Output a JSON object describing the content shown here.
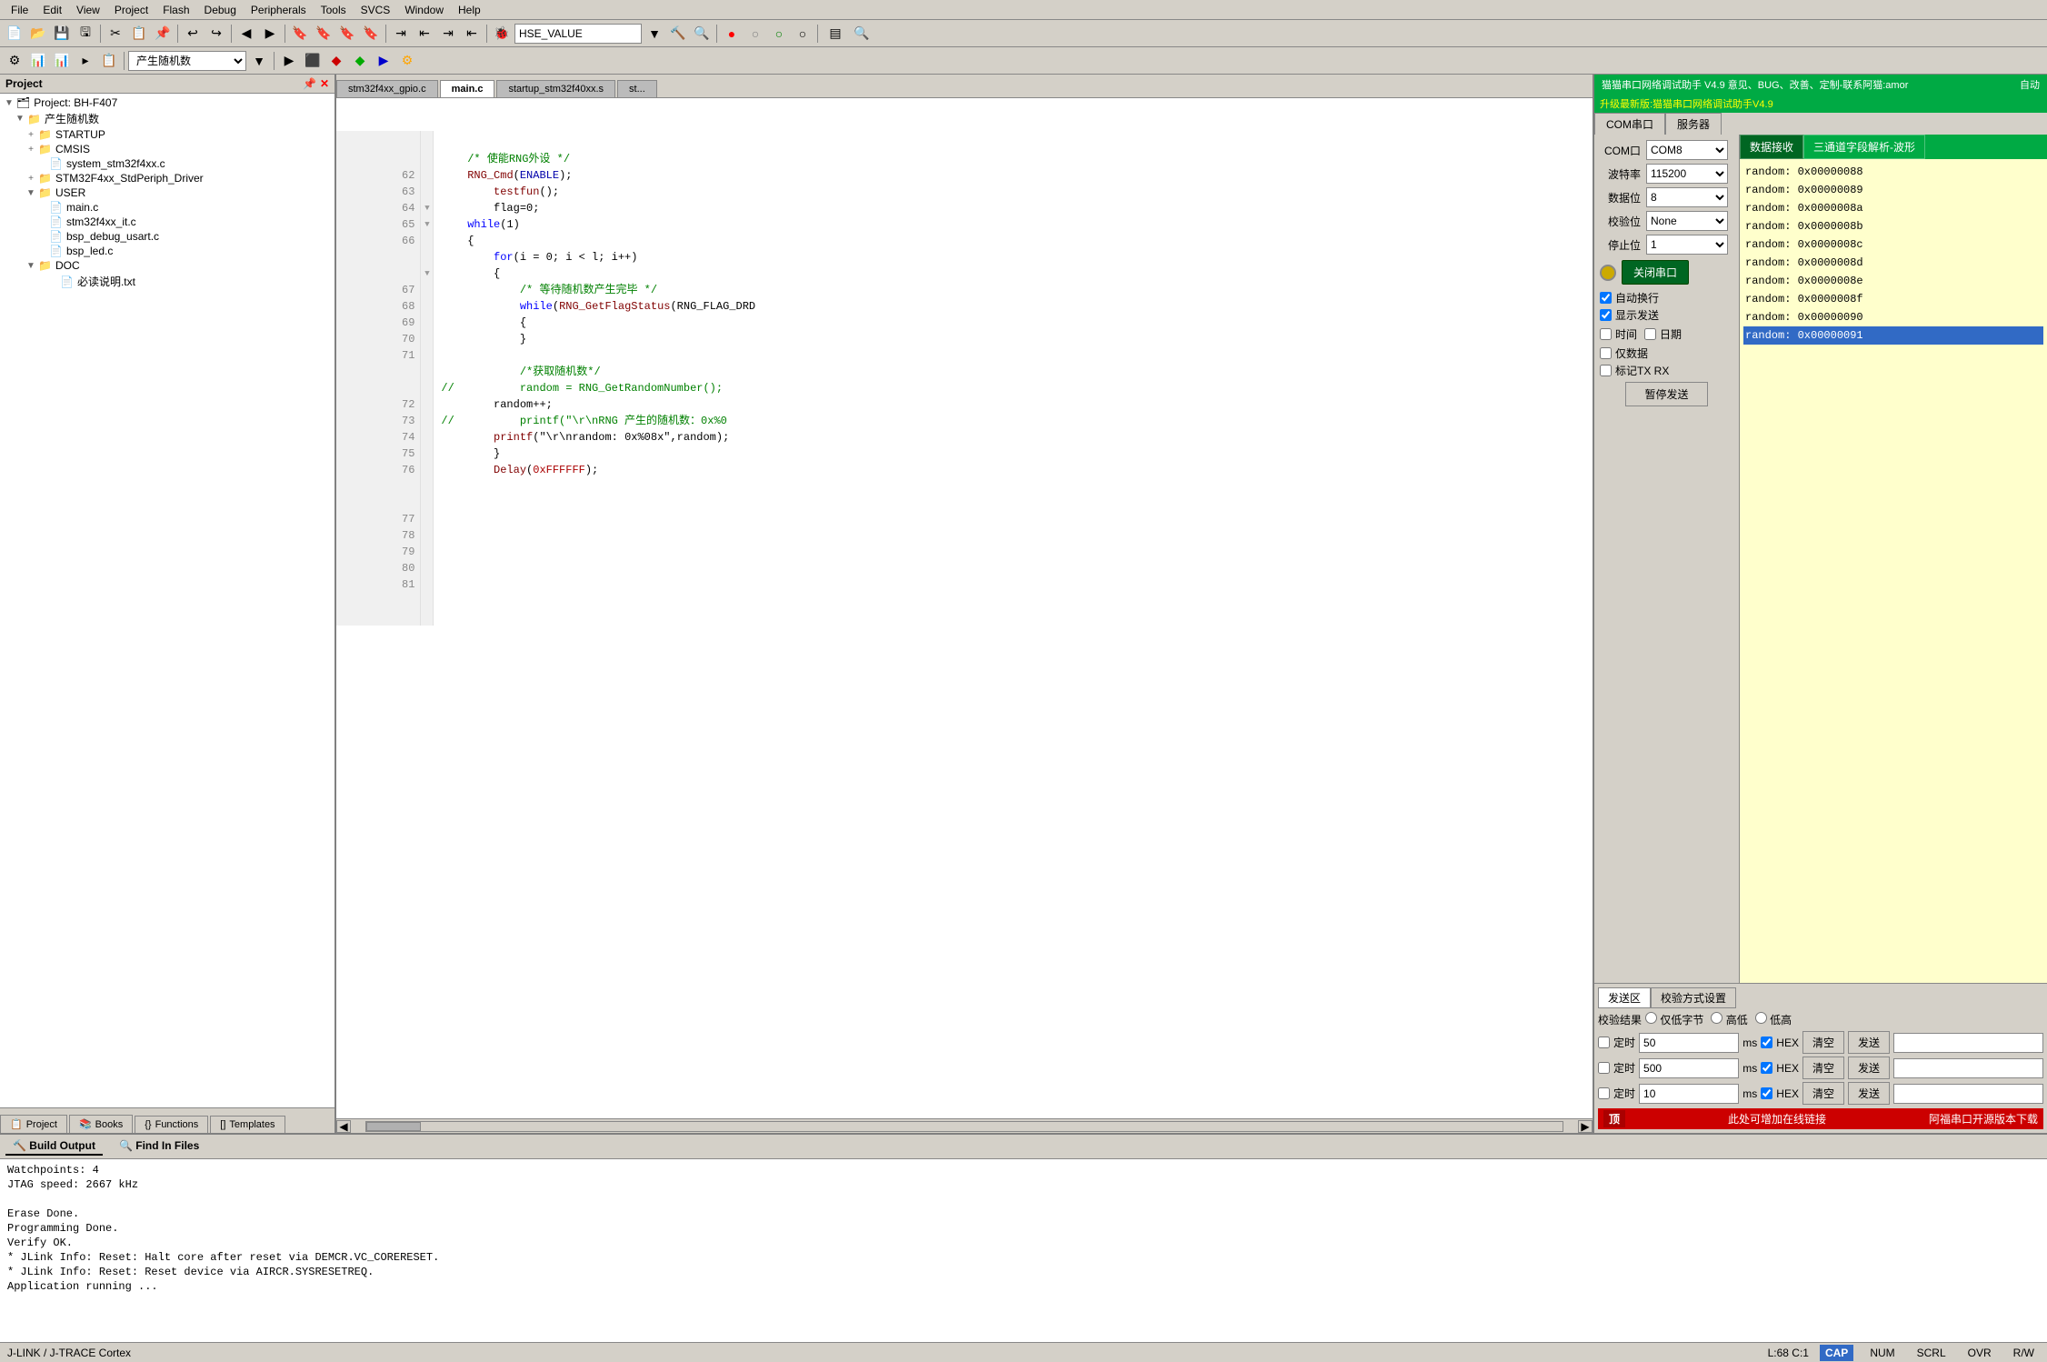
{
  "menu": {
    "items": [
      "File",
      "Edit",
      "View",
      "Project",
      "Flash",
      "Debug",
      "Peripherals",
      "Tools",
      "SVCS",
      "Window",
      "Help"
    ]
  },
  "toolbar": {
    "hse_value": "HSE_VALUE",
    "random_btn": "产生随机数"
  },
  "project_panel": {
    "title": "Project",
    "tree": [
      {
        "label": "Project: BH-F407",
        "level": 0,
        "type": "project",
        "expanded": true
      },
      {
        "label": "产生随机数",
        "level": 1,
        "type": "folder",
        "expanded": true
      },
      {
        "label": "STARTUP",
        "level": 2,
        "type": "folder",
        "expanded": true
      },
      {
        "label": "CMSIS",
        "level": 2,
        "type": "folder",
        "expanded": true
      },
      {
        "label": "system_stm32f4xx.c",
        "level": 3,
        "type": "file"
      },
      {
        "label": "STM32F4xx_StdPeriph_Driver",
        "level": 2,
        "type": "folder",
        "expanded": false
      },
      {
        "label": "USER",
        "level": 2,
        "type": "folder",
        "expanded": true
      },
      {
        "label": "main.c",
        "level": 3,
        "type": "file"
      },
      {
        "label": "stm32f4xx_it.c",
        "level": 3,
        "type": "file"
      },
      {
        "label": "bsp_debug_usart.c",
        "level": 3,
        "type": "file"
      },
      {
        "label": "bsp_led.c",
        "level": 3,
        "type": "file"
      },
      {
        "label": "DOC",
        "level": 2,
        "type": "folder",
        "expanded": true
      },
      {
        "label": "必读说明.txt",
        "level": 3,
        "type": "file"
      }
    ],
    "tabs": [
      {
        "label": "Project",
        "icon": "📋",
        "active": false
      },
      {
        "label": "Books",
        "icon": "📚",
        "active": false
      },
      {
        "label": "Functions",
        "icon": "{}",
        "active": false
      },
      {
        "label": "Templates",
        "icon": "[]",
        "active": false
      }
    ]
  },
  "editor": {
    "tabs": [
      {
        "label": "stm32f4xx_gpio.c",
        "active": false
      },
      {
        "label": "main.c",
        "active": true
      },
      {
        "label": "startup_stm32f40xx.s",
        "active": false
      },
      {
        "label": "st...",
        "active": false
      }
    ],
    "lines": [
      {
        "num": 62,
        "fold": "",
        "text": "    /* 使能RNG外设 */"
      },
      {
        "num": 63,
        "fold": "",
        "text": "    RNG_Cmd(ENABLE);"
      },
      {
        "num": 64,
        "fold": "",
        "text": "        testfun();"
      },
      {
        "num": 65,
        "fold": "",
        "text": "        flag=0;"
      },
      {
        "num": 66,
        "fold": "",
        "text": "    while(1)"
      },
      {
        "num": 67,
        "fold": "▼",
        "text": "    {"
      },
      {
        "num": 68,
        "fold": "",
        "text": "        for(i = 0; i < l; i++)"
      },
      {
        "num": 69,
        "fold": "▼",
        "text": "        {"
      },
      {
        "num": 70,
        "fold": "",
        "text": "            /* 等待随机数产生完毕 */"
      },
      {
        "num": 71,
        "fold": "",
        "text": "            while(RNG_GetFlagStatus(RNG_FLAG_DRD"
      },
      {
        "num": 72,
        "fold": "▼",
        "text": "            {"
      },
      {
        "num": 73,
        "fold": "",
        "text": "            }"
      },
      {
        "num": 74,
        "fold": "",
        "text": ""
      },
      {
        "num": 75,
        "fold": "",
        "text": "            /*获取随机数*/"
      },
      {
        "num": 76,
        "fold": "",
        "text": "//          random = RNG_GetRandomNumber();"
      },
      {
        "num": 77,
        "fold": "",
        "text": "        random++;"
      },
      {
        "num": 78,
        "fold": "",
        "text": "//          printf(\"\\r\\nRNG 产生的随机数：0x%0"
      },
      {
        "num": 79,
        "fold": "",
        "text": "        printf(\"\\r\\nrandom: 0x%08x\",random);"
      },
      {
        "num": 80,
        "fold": "",
        "text": "        }"
      },
      {
        "num": 81,
        "fold": "",
        "text": "        Delay(0xFFFFFF);"
      }
    ]
  },
  "serial": {
    "app_name": "猫猫串口网络调试助手 V4.9 意见、BUG、改善、定制-联系阿猫:amor",
    "upgrade": "升级最新版:猫猫串口网络调试助手V4.9",
    "auto_label": "自动",
    "tabs_main": [
      "COM串口",
      "服务器"
    ],
    "tabs_sub": [
      "数据接收",
      "三通道字段解析-波形"
    ],
    "settings": {
      "com_label": "COM口",
      "com_value": "COM8",
      "baud_label": "波特率",
      "baud_value": "115200",
      "data_label": "数据位",
      "data_value": "8",
      "parity_label": "校验位",
      "parity_value": "None",
      "stop_label": "停止位",
      "stop_value": "1",
      "close_btn": "关闭串口"
    },
    "checkboxes": [
      {
        "label": "自动换行",
        "checked": true
      },
      {
        "label": "显示发送",
        "checked": true
      },
      {
        "label": "时间",
        "checked": false
      },
      {
        "label": "日期",
        "checked": false
      },
      {
        "label": "仅数据",
        "checked": false
      },
      {
        "label": "标记TX RX",
        "checked": false
      }
    ],
    "pause_btn": "暂停发送",
    "data_lines": [
      {
        "text": "random: 0x00000088",
        "highlight": false
      },
      {
        "text": "random: 0x00000089",
        "highlight": false
      },
      {
        "text": "random: 0x0000008a",
        "highlight": false
      },
      {
        "text": "random: 0x0000008b",
        "highlight": false
      },
      {
        "text": "random: 0x0000008c",
        "highlight": false
      },
      {
        "text": "random: 0x0000008d",
        "highlight": false
      },
      {
        "text": "random: 0x0000008e",
        "highlight": false
      },
      {
        "text": "random: 0x0000008f",
        "highlight": false
      },
      {
        "text": "random: 0x00000090",
        "highlight": false
      },
      {
        "text": "random: 0x00000091",
        "highlight": true
      }
    ],
    "send_area": {
      "tab1": "发送区",
      "tab2": "校验方式设置",
      "verify_label": "校验结果",
      "verify_opts": [
        "仅低字节",
        "高低",
        "低高"
      ],
      "send_rows": [
        {
          "timer_label": "定时",
          "timer_val": "50",
          "ms_label": "ms",
          "hex_checked": true,
          "clear_btn": "清空",
          "send_btn": "发送"
        },
        {
          "timer_label": "定时",
          "timer_val": "500",
          "ms_label": "ms",
          "hex_checked": true,
          "clear_btn": "清空",
          "send_btn": "发送"
        },
        {
          "timer_label": "定时",
          "timer_val": "10",
          "ms_label": "ms",
          "hex_checked": true,
          "clear_btn": "清空",
          "send_btn": "发送"
        }
      ],
      "footer_link": "此处可增加在线链接",
      "footer_right": "阿福串口开源版本下载"
    }
  },
  "build_output": {
    "title": "Build Output",
    "tabs": [
      "Build Output",
      "Find In Files"
    ],
    "lines": [
      "Watchpoints:        4",
      "JTAG speed: 2667 kHz",
      "",
      "Erase Done.",
      "Programming Done.",
      "Verify OK.",
      "* JLink Info: Reset: Halt core after reset via DEMCR.VC_CORERESET.",
      "* JLink Info: Reset: Reset device via AIRCR.SYSRESETREQ.",
      "Application running ..."
    ]
  },
  "status_bar": {
    "left": "J-LINK / J-TRACE Cortex",
    "pos": "L:68 C:1",
    "cap": "CAP",
    "num": "NUM",
    "scrl": "SCRL",
    "ovr": "OVR",
    "rw": "R/W"
  }
}
